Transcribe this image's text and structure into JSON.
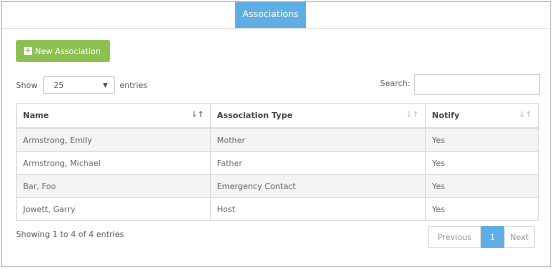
{
  "tab": {
    "label": "Associations"
  },
  "toolbar": {
    "new_label": "New Association",
    "plus_glyph": "+"
  },
  "length": {
    "show": "Show",
    "value": "25",
    "entries": "entries"
  },
  "search": {
    "label": "Search:",
    "value": ""
  },
  "table": {
    "columns": [
      "Name",
      "Association Type",
      "Notify"
    ],
    "rows": [
      [
        "Armstrong, Emily",
        "Mother",
        "Yes"
      ],
      [
        "Armstrong, Michael",
        "Father",
        "Yes"
      ],
      [
        "Bar, Foo",
        "Emergency Contact",
        "Yes"
      ],
      [
        "Jowett, Garry",
        "Host",
        "Yes"
      ]
    ]
  },
  "info": {
    "text": "Showing 1 to 4 of 4 entries"
  },
  "pagination": {
    "previous": "Previous",
    "current": "1",
    "next": "Next"
  },
  "colors": {
    "accent": "#5faee3",
    "button": "#8cc152"
  }
}
